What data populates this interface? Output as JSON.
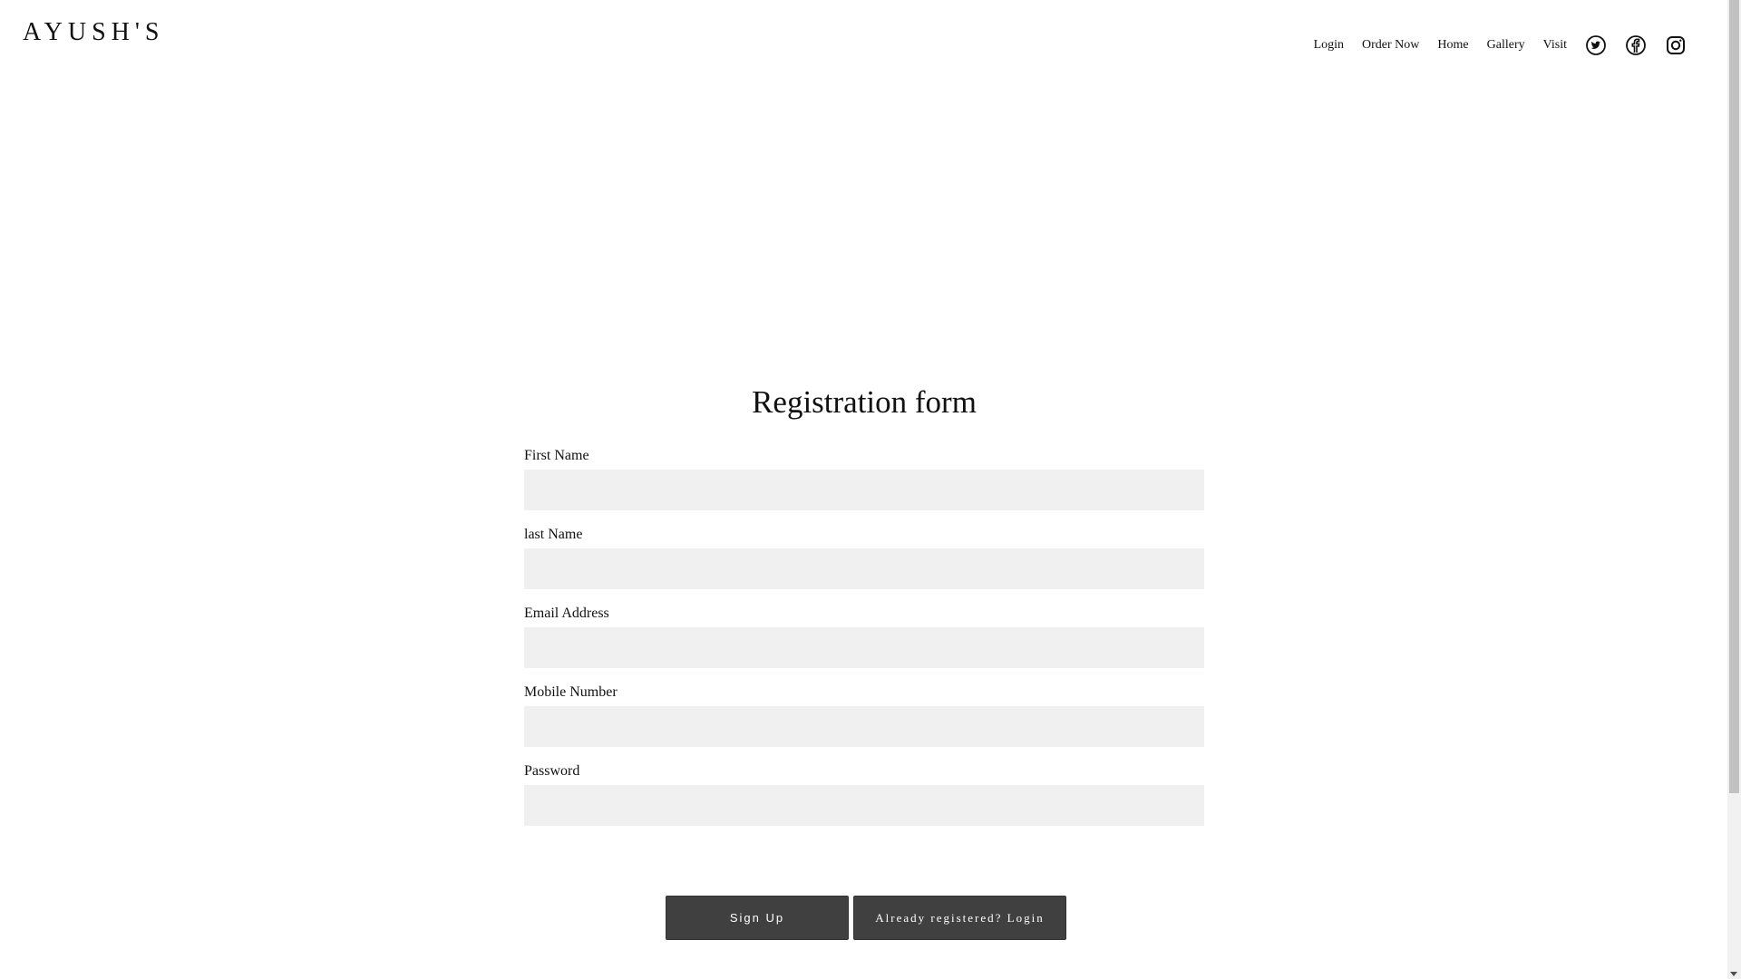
{
  "header": {
    "brand": "AYUSH'S",
    "nav": [
      {
        "label": "Login"
      },
      {
        "label": "Order Now"
      },
      {
        "label": "Home"
      },
      {
        "label": "Gallery"
      },
      {
        "label": "Visit"
      }
    ],
    "social_icons": [
      "twitter-icon",
      "facebook-icon",
      "instagram-icon"
    ]
  },
  "form": {
    "title": "Registration form",
    "fields": [
      {
        "label": "First Name",
        "value": ""
      },
      {
        "label": "last Name",
        "value": ""
      },
      {
        "label": "Email Address",
        "value": ""
      },
      {
        "label": "Mobile Number",
        "value": ""
      },
      {
        "label": "Password",
        "value": ""
      }
    ],
    "signup_label": "Sign Up",
    "login_label": "Already registered? Login"
  },
  "colors": {
    "button_bg": "#404040",
    "input_bg": "#f0f0f0"
  }
}
